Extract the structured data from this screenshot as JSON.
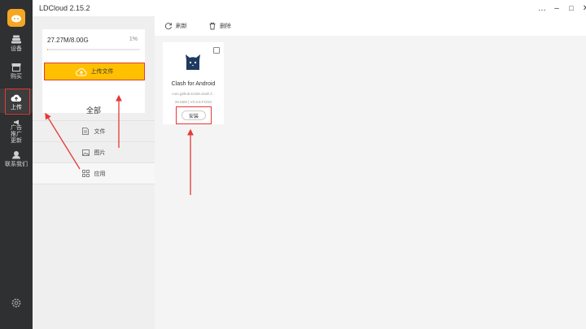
{
  "app": {
    "title": "LDCloud 2.15.2"
  },
  "window_controls": {
    "more": "…",
    "minimize": "–",
    "maximize": "□",
    "close": "✕"
  },
  "sidebar": {
    "items": [
      {
        "label": "设备",
        "icon": "phone-stack-icon"
      },
      {
        "label": "购买",
        "icon": "store-icon"
      },
      {
        "label": "上传",
        "icon": "cloud-upload-icon",
        "active": true
      },
      {
        "label": "广告\n推广\n更新",
        "icon": "megaphone-icon"
      },
      {
        "label": "联系我们",
        "icon": "contact-icon"
      }
    ],
    "settings_icon": "gear-icon"
  },
  "storage": {
    "used": "27.27M/8.00G",
    "percent_label": "1%",
    "fraction": 0.01
  },
  "upload_button": {
    "label": "上传文件"
  },
  "categories": [
    {
      "label": "全部"
    },
    {
      "label": "文件",
      "icon": "document-icon"
    },
    {
      "label": "图片",
      "icon": "image-icon"
    },
    {
      "label": "应用",
      "icon": "apps-grid-icon",
      "selected": true
    }
  ],
  "toolbar": {
    "refresh_label": "刷新",
    "delete_label": "删除"
  },
  "app_card": {
    "name": "Clash for Android",
    "package": "com.github.kr328.clash.f...",
    "meta": "26.55M | V2.5.8.FOSS",
    "install_label": "安装"
  },
  "colors": {
    "accent": "#ffc000",
    "sidebar": "#2f3031",
    "annotation": "#e53935"
  }
}
